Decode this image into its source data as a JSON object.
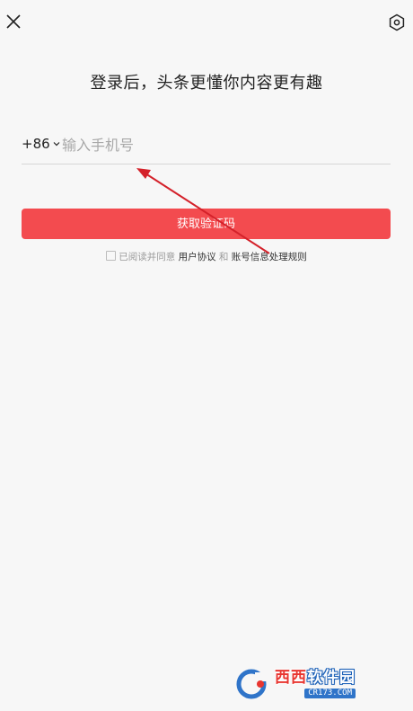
{
  "header": {
    "close_icon": "close-icon",
    "settings_icon": "hexagon-settings-icon"
  },
  "headline": "登录后，头条更懂你内容更有趣",
  "phone": {
    "country_code": "+86",
    "placeholder": "输入手机号",
    "value": ""
  },
  "get_code_button": "获取验证码",
  "agreement": {
    "prefix": "已阅读并同意",
    "user_agreement": "用户协议",
    "and": "和",
    "privacy_rules": "账号信息处理规则"
  },
  "watermark": {
    "title_red": "西西",
    "title_rest": "软件园",
    "sub": "CR173.COM"
  },
  "colors": {
    "accent": "#f34b4f",
    "background": "#f7f7f7",
    "annotation_arrow": "#d4212a"
  }
}
